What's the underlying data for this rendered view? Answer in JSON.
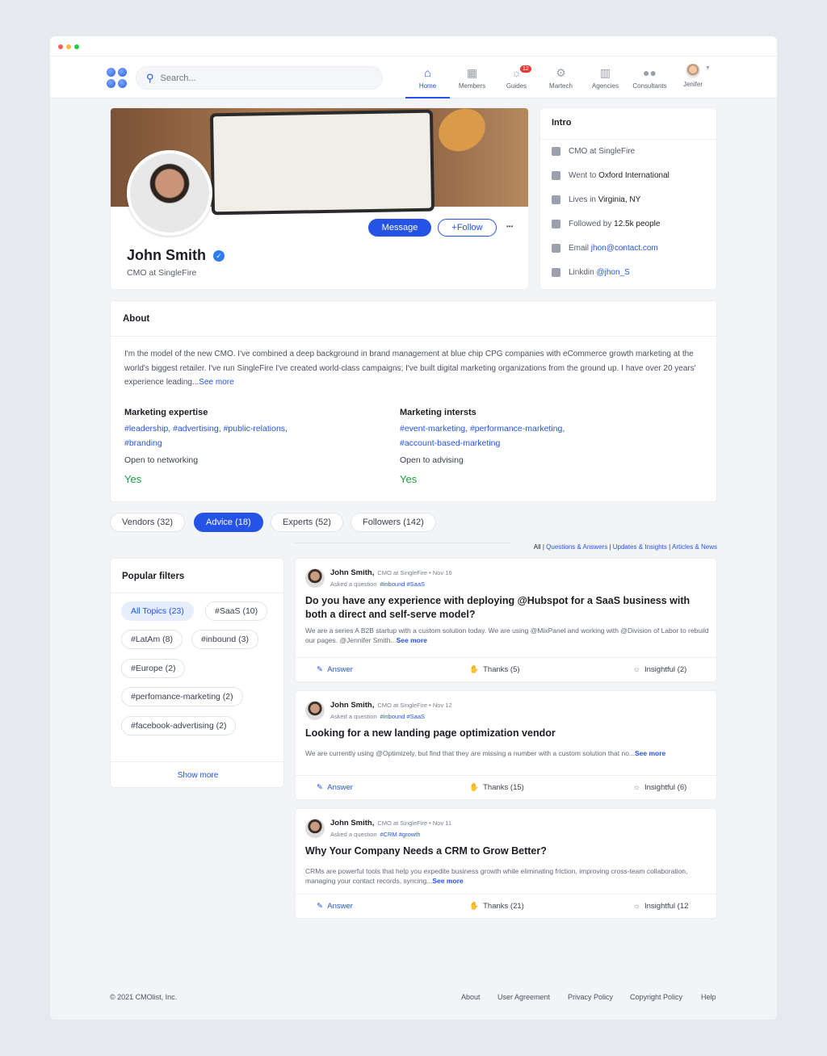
{
  "window": {
    "dots": [
      "#ff5f57",
      "#febc2e",
      "#28c840"
    ]
  },
  "header": {
    "search_placeholder": "Search...",
    "nav": [
      {
        "label": "Home",
        "icon": "home-icon",
        "active": true
      },
      {
        "label": "Members",
        "icon": "contacts-icon"
      },
      {
        "label": "Guides",
        "icon": "lightbulb-icon",
        "badge": "12"
      },
      {
        "label": "Martech",
        "icon": "megaphone-icon"
      },
      {
        "label": "Agencies",
        "icon": "building-icon"
      },
      {
        "label": "Consultants",
        "icon": "users-icon"
      }
    ],
    "user": "Jenifer"
  },
  "profile": {
    "name": "John Smith",
    "title": "CMO at SingleFire",
    "message": "Message",
    "follow": "+Follow",
    "more": "•••"
  },
  "intro": {
    "title": "Intro",
    "rows": [
      {
        "icon": "briefcase-icon",
        "pre": "CMO at SingleFire",
        "val": ""
      },
      {
        "icon": "graduation-cap-icon",
        "pre": "Went to ",
        "val": "Oxford International"
      },
      {
        "icon": "location-icon",
        "pre": "Lives in ",
        "val": "Virginia, NY"
      },
      {
        "icon": "followers-icon",
        "pre": "Followed by ",
        "val": "12.5k people"
      },
      {
        "icon": "email-icon",
        "pre": "Email ",
        "link": "jhon@contact.com"
      },
      {
        "icon": "linkedin-icon",
        "pre": "Linkdin ",
        "link": "@jhon_S"
      }
    ]
  },
  "about": {
    "title": "About",
    "text": "I'm the model of the new CMO. I've combined a deep background in brand management at blue chip CPG companies with eCommerce growth marketing at the world's biggest retailer. I've run SingleFire I've created world-class campaigns; I've built digital marketing organizations from the ground up. I have over 20 years' experience leading...",
    "see_more": "See more",
    "expertise_label": "Marketing expertise",
    "expertise": "#leadership, #advertising, #public-relations, #branding",
    "interests_label": "Marketing intersts",
    "interests": "#event-marketing, #performance-marketing, #account-based-marketing",
    "networking_label": "Open to networking",
    "networking": "Yes",
    "advising_label": "Open to advising",
    "advising": "Yes"
  },
  "tabs": [
    "Vendors (32)",
    "Advice (18)",
    "Experts (52)",
    "Followers (142)"
  ],
  "active_tab": 1,
  "filters_links": [
    "All",
    "Questions & Answers",
    "Updates & Insights",
    "Articles & News"
  ],
  "popular": {
    "title": "Popular filters",
    "chips": [
      "All Topics (23)",
      "#SaaS (10)",
      "#LatAm (8)",
      "#inbound (3)",
      "#Europe (2)",
      "#perfomance-marketing (2)",
      "#facebook-advertising (2)"
    ],
    "show_more": "Show more"
  },
  "posts": [
    {
      "author": "John Smith,",
      "meta": "CMO at SingleFire • Nov 16",
      "action": "Asked a question",
      "tags": "#inbound #SaaS",
      "title": "Do you have any experience with deploying @Hubspot for a SaaS business with both a direct and self-serve model?",
      "body": "We are a series A B2B startup with a custom solution today. We are using @MixPanel and working with @Division of Labor to rebuild our pages. @Jennifer Smith...",
      "see_more": "See more",
      "answer": "Answer",
      "thanks": "Thanks (5)",
      "insightful": "Insightful (2)"
    },
    {
      "author": "John Smith,",
      "meta": "CMO at SingleFire • Nov 12",
      "action": "Asked a question",
      "tags": "#inbound #SaaS",
      "title": "Looking for a new landing page optimization vendor",
      "body": "We are currently using @Optimizely, but find that they are missing a number with a custom solution that no...",
      "see_more": "See more",
      "answer": "Answer",
      "thanks": "Thanks (15)",
      "insightful": "Insightful (6)"
    },
    {
      "author": "John Smith,",
      "meta": "CMO at SingleFire • Nov 11",
      "action": "Asked a question",
      "tags": "#CRM #growth",
      "title": "Why Your Company Needs a CRM to Grow Better?",
      "body": "CRMs are powerful tools that help you expedite business growth while eliminating friction, improving cross-team collaboration, managing your contact records, syncing...",
      "see_more": "See more",
      "answer": "Answer",
      "thanks": "Thanks (21)",
      "insightful": "Insightful (12"
    }
  ],
  "footer": {
    "copyright": "© 2021 CMOlist, Inc.",
    "links": [
      "About",
      "User Agreement",
      "Privacy Policy",
      "Copyright Policy",
      "Help"
    ]
  },
  "colors": {
    "accent": "#2453e6",
    "success": "#1a9e3f"
  }
}
